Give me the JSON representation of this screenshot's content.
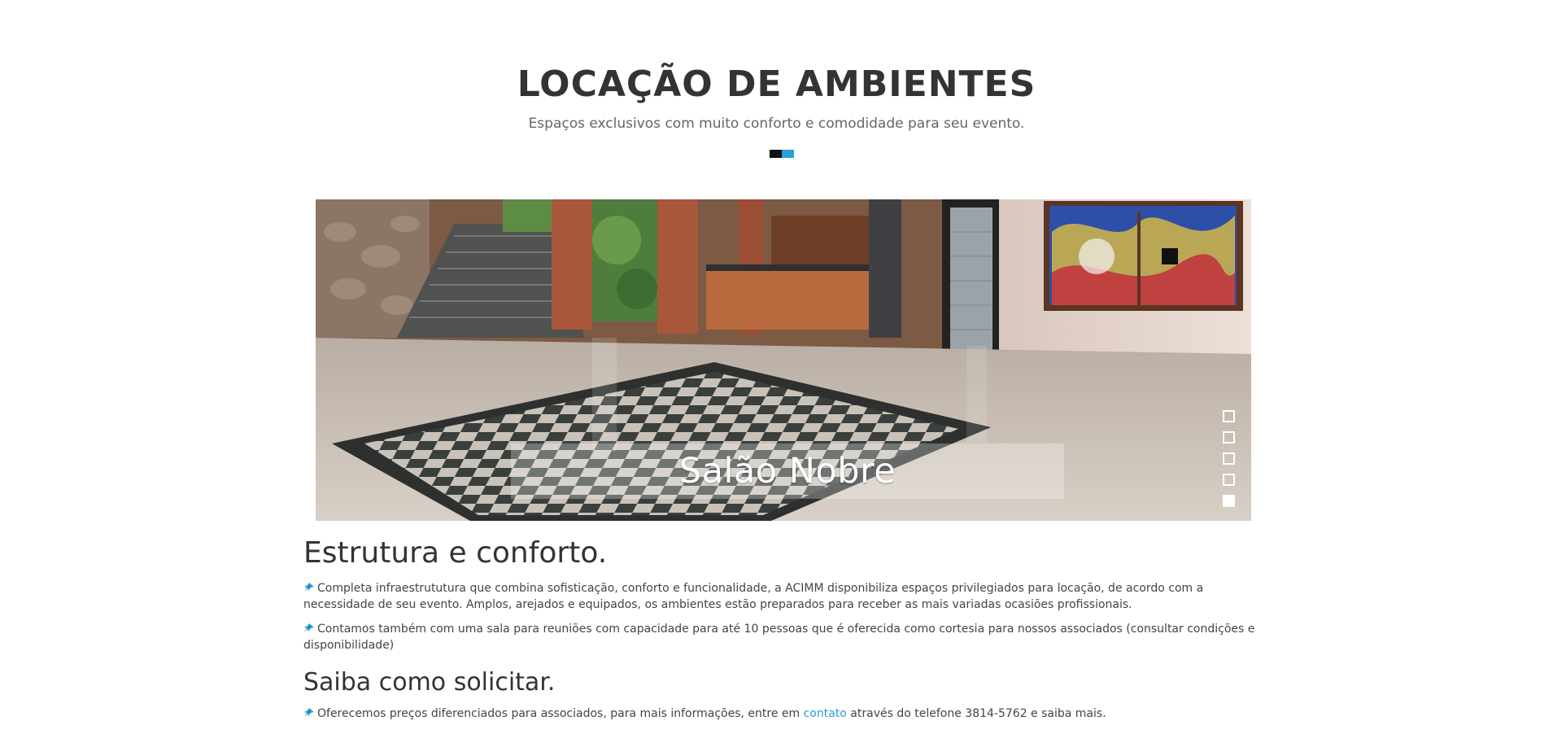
{
  "header": {
    "title": "LOCAÇÃO DE AMBIENTES",
    "subtitle": "Espaços exclusivos com muito conforto e comodidade para seu evento."
  },
  "colors": {
    "accent": "#2a9fd8",
    "divider_dark": "#111111",
    "text": "#333333"
  },
  "slider": {
    "caption": "Salão Nobre",
    "slide_count": 5,
    "active_slide": 5
  },
  "section1": {
    "heading": "Estrutura e conforto.",
    "paragraphs": [
      "Completa infraestrututura que combina sofisticação, conforto e funcionalidade, a ACIMM disponibiliza espaços privilegiados para locação, de acordo com a necessidade de seu evento. Amplos, arejados e equipados, os ambientes estão preparados para receber as mais variadas ocasiões profissionais.",
      "Contamos também com uma sala para reuniões com capacidade para até 10 pessoas que é oferecida como cortesia para nossos associados (consultar condições e disponibilidade)"
    ]
  },
  "section2": {
    "heading": "Saiba como solicitar.",
    "text_before_link": "Oferecemos preços diferenciados para associados, para mais informações, entre em ",
    "link_text": "contato",
    "text_after_link": " através do telefone 3814-5762 e saiba mais."
  },
  "icons": {
    "bullet": "pushpin-icon"
  }
}
